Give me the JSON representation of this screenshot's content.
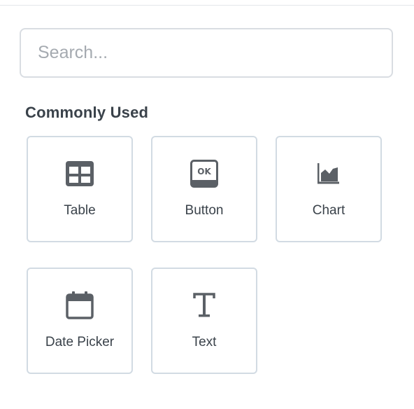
{
  "search": {
    "placeholder": "Search..."
  },
  "section": {
    "title": "Commonly Used"
  },
  "tiles": [
    {
      "label": "Table",
      "icon": "table-icon"
    },
    {
      "label": "Button",
      "icon": "button-ok-icon",
      "icon_text": "OK"
    },
    {
      "label": "Chart",
      "icon": "area-chart-icon"
    },
    {
      "label": "Date Picker",
      "icon": "calendar-icon"
    },
    {
      "label": "Text",
      "icon": "text-t-icon"
    }
  ],
  "colors": {
    "icon": "#5b6066",
    "tile_border": "#d2dbe3",
    "text": "#3a424a",
    "placeholder": "#a5aab0"
  }
}
